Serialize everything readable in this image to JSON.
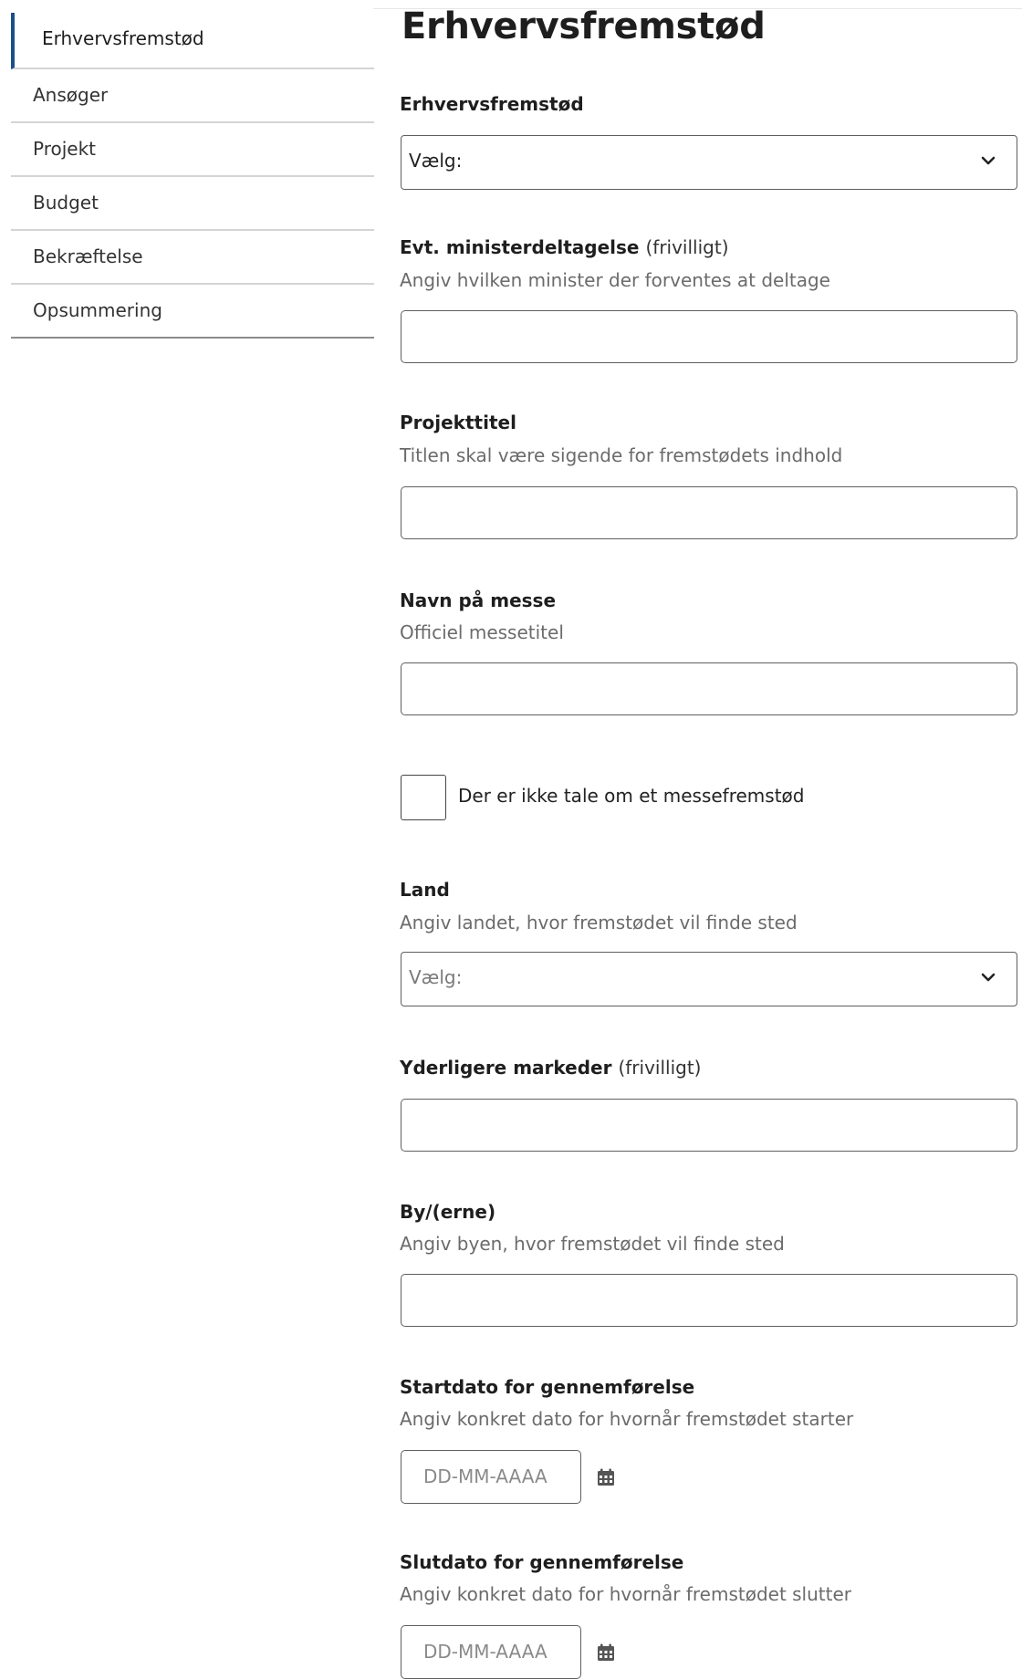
{
  "sidebar": {
    "items": [
      {
        "label": "Erhvervsfremstød",
        "active": true
      },
      {
        "label": "Ansøger"
      },
      {
        "label": "Projekt"
      },
      {
        "label": "Budget"
      },
      {
        "label": "Bekræftelse"
      },
      {
        "label": "Opsummering"
      }
    ],
    "active_color": "#1b4f8a"
  },
  "main": {
    "title": "Erhvervsfremstød",
    "fields": {
      "type": {
        "label": "Erhvervsfremstød",
        "value": "Vælg:"
      },
      "minister": {
        "label": "Evt. ministerdeltagelse",
        "optional": "(frivilligt)",
        "help": "Angiv hvilken minister der forventes at deltage",
        "value": ""
      },
      "project_title": {
        "label": "Projekttitel",
        "help": "Titlen skal være sigende for fremstødets indhold",
        "value": ""
      },
      "fair_name": {
        "label": "Navn på messe",
        "help": "Officiel messetitel",
        "value": ""
      },
      "no_fair": {
        "label": "Der er ikke tale om et messefremstød",
        "checked": false
      },
      "country": {
        "label": "Land",
        "help": "Angiv landet, hvor fremstødet vil finde sted",
        "value": "Vælg:"
      },
      "markets": {
        "label": "Yderligere markeder",
        "optional": "(frivilligt)",
        "value": ""
      },
      "cities": {
        "label": "By/(erne)",
        "help": "Angiv byen, hvor fremstødet vil finde sted",
        "value": ""
      },
      "start_date": {
        "label": "Startdato for gennemførelse",
        "help": "Angiv konkret dato for hvornår fremstødet starter",
        "placeholder": "DD-MM-AAAA",
        "icon": "calendar-icon"
      },
      "end_date": {
        "label": "Slutdato for gennemførelse",
        "help": "Angiv konkret dato for hvornår fremstødet slutter",
        "placeholder": "DD-MM-AAAA",
        "icon": "calendar-icon"
      }
    }
  }
}
